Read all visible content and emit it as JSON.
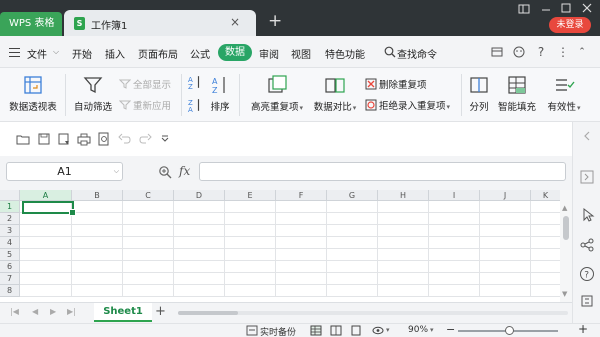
{
  "tabs": {
    "app_label": "WPS 表格",
    "doc_icon": "S",
    "doc_name": "工作簿1",
    "tab_close": "×",
    "new_tab": "+",
    "login": "未登录"
  },
  "menu": {
    "file": "文件",
    "items": [
      "开始",
      "插入",
      "页面布局",
      "公式"
    ],
    "active": "数据",
    "items_after": [
      "审阅",
      "视图",
      "特色功能"
    ],
    "search": "查找命令"
  },
  "ribbon": {
    "pivot": "数据透视表",
    "autofilter": "自动筛选",
    "show_all": "全部显示",
    "reapply": "重新应用",
    "sort": "排序",
    "highlight_dup": "高亮重复项",
    "compare": "数据对比",
    "remove_dup": "删除重复项",
    "reject_dup": "拒绝录入重复项",
    "split": "分列",
    "smart_fill": "智能填充",
    "validity": "有效性"
  },
  "formula": {
    "name_box": "A1",
    "fx": "fx",
    "value": ""
  },
  "grid": {
    "columns": [
      "A",
      "B",
      "C",
      "D",
      "E",
      "F",
      "G",
      "H",
      "I",
      "J",
      "K"
    ],
    "rows": [
      "1",
      "2",
      "3",
      "4",
      "5",
      "6",
      "7",
      "8"
    ],
    "active_cell": "A1"
  },
  "sheets": {
    "tabs": [
      "Sheet1"
    ],
    "add": "+"
  },
  "status": {
    "backup": "实时备份",
    "zoom": "90%",
    "minus": "−",
    "plus": "+"
  },
  "colors": {
    "accent": "#2ea44f",
    "titlebar": "#2f3437",
    "login": "#e8483d"
  }
}
